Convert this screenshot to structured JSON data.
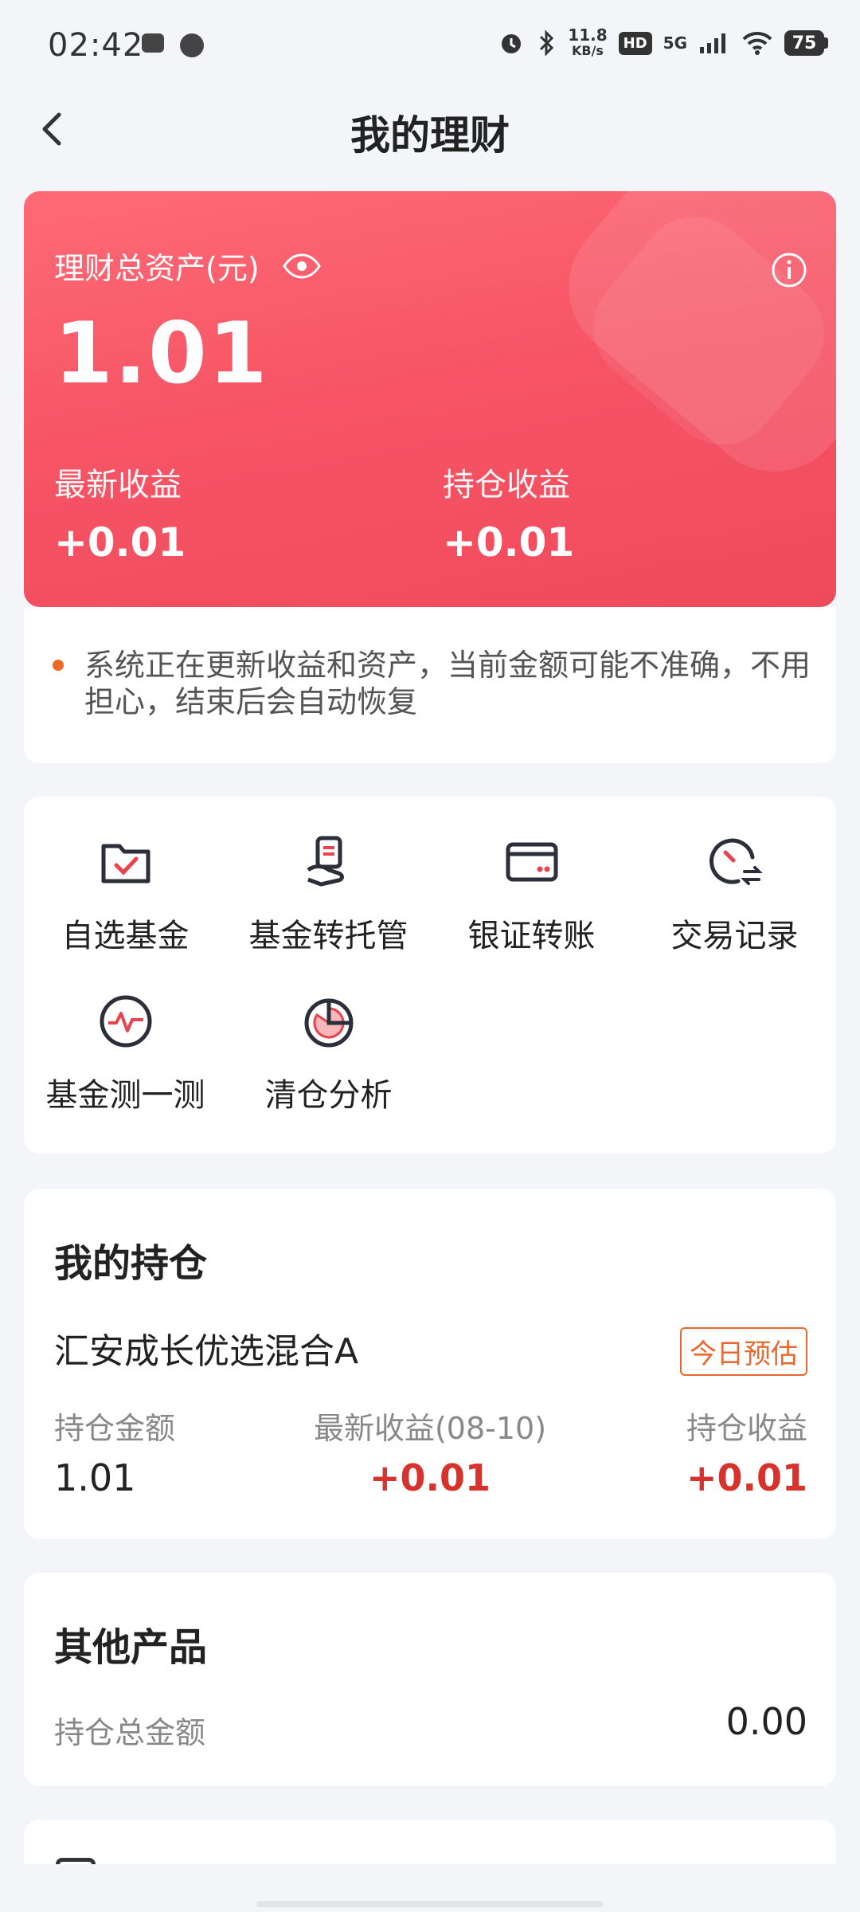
{
  "status_bar": {
    "time": "02:42",
    "net_speed_value": "11.8",
    "net_speed_unit": "KB/s",
    "hd": "HD",
    "network": "5G",
    "battery": "75"
  },
  "header": {
    "title": "我的理财"
  },
  "asset_card": {
    "label": "理财总资产(元)",
    "total": "1.01",
    "latest_label": "最新收益",
    "latest_value": "+0.01",
    "holding_label": "持仓收益",
    "holding_value": "+0.01"
  },
  "notice": {
    "text": "系统正在更新收益和资产，当前金额可能不准确，不用担心，结束后会自动恢复"
  },
  "menu": {
    "items": [
      {
        "label": "自选基金",
        "icon": "folder-check-icon"
      },
      {
        "label": "基金转托管",
        "icon": "transfer-custody-icon"
      },
      {
        "label": "银证转账",
        "icon": "card-icon"
      },
      {
        "label": "交易记录",
        "icon": "clock-exchange-icon"
      },
      {
        "label": "基金测一测",
        "icon": "pulse-icon"
      },
      {
        "label": "清仓分析",
        "icon": "pie-chart-icon"
      }
    ]
  },
  "holdings": {
    "title": "我的持仓",
    "fund_name": "汇安成长优选混合A",
    "badge": "今日预估",
    "amount_label": "持仓金额",
    "latest_label": "最新收益(08-10)",
    "profit_label": "持仓收益",
    "amount_value": "1.01",
    "latest_value": "+0.01",
    "profit_value": "+0.01"
  },
  "other": {
    "title": "其他产品",
    "total_label": "持仓总金额",
    "total_value": "0.00"
  },
  "colors": {
    "card_red": "#f65566",
    "profit_red": "#d8322c",
    "badge_orange": "#e8692f",
    "background": "#f3f5f9"
  }
}
